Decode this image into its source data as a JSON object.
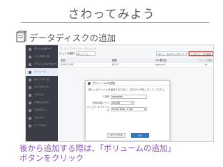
{
  "slide": {
    "title": "さわってみよう",
    "section_label": "データディスクの追加",
    "caption_line1": "後から追加する際は、「ボリュームの追加」",
    "caption_line2": "ボタンをクリック"
  },
  "sidebar": {
    "items": [
      {
        "label": "ダッシュボード",
        "active": false
      },
      {
        "label": "インスタンス",
        "active": false
      },
      {
        "label": "アフィニティグループ",
        "active": false
      },
      {
        "label": "ストレージ",
        "active": true
      },
      {
        "label": "ネットワーク",
        "active": false
      },
      {
        "label": "テンプレート",
        "active": false
      },
      {
        "label": "イベント",
        "active": false
      },
      {
        "label": "プロジェクト",
        "active": false
      },
      {
        "label": "アカウント",
        "active": false
      },
      {
        "label": "ドメイン",
        "active": false
      },
      {
        "label": "リージョン",
        "active": false
      }
    ]
  },
  "main": {
    "breadcrumb": "ホーム > ストレージ - ボリューム",
    "view_label": "ビューの選択",
    "view_value": "ボリューム",
    "upload_button": "ボリュームのアップロード",
    "add_button": "+ ボリュームの追加",
    "table": {
      "headers": [
        "名前",
        "種類",
        "VM 表示名",
        "クイック表示"
      ],
      "rows": [
        [
          "ROOT-1482",
          "ROOT",
          "test-vm1",
          "+"
        ]
      ]
    }
  },
  "modal": {
    "title": "ボリュームの追加",
    "description": "新しいボリュームを追加するために、次のデータを入力してください。",
    "fields": [
      {
        "label": "* 名前",
        "value": "datadisk"
      },
      {
        "label": "利用可能ゾーン",
        "value": "Zone4"
      },
      {
        "label": "ディスク オファリング",
        "value": "Small Disk, 5 GB"
      }
    ],
    "cancel_label": "キャンセル",
    "ok_label": "OK"
  }
}
